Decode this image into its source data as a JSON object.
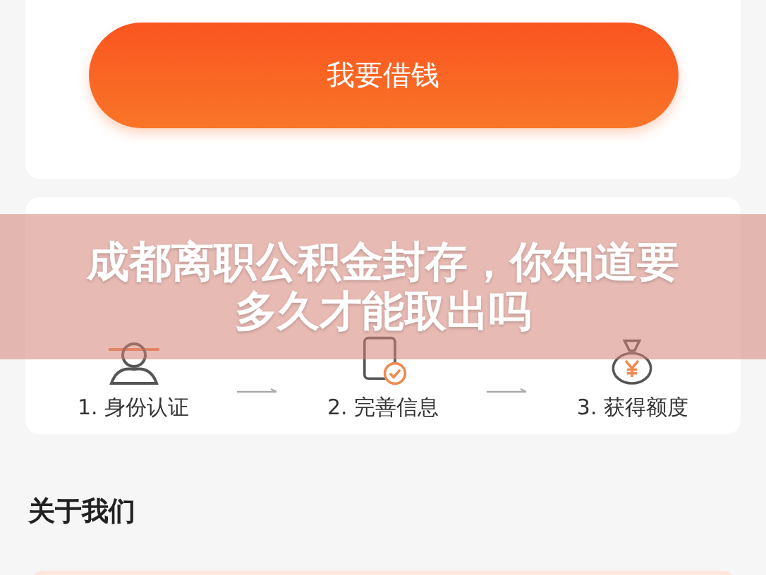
{
  "loan_button": {
    "label": "我要借钱"
  },
  "steps": [
    {
      "kind": "identity",
      "label": "1. 身份认证"
    },
    {
      "kind": "info",
      "label": "2. 完善信息"
    },
    {
      "kind": "quota",
      "label": "3. 获得额度"
    }
  ],
  "about": {
    "title": "关于我们"
  },
  "banner": {
    "title": "成都离职公积金封存，你知道要多久才能取出吗"
  }
}
